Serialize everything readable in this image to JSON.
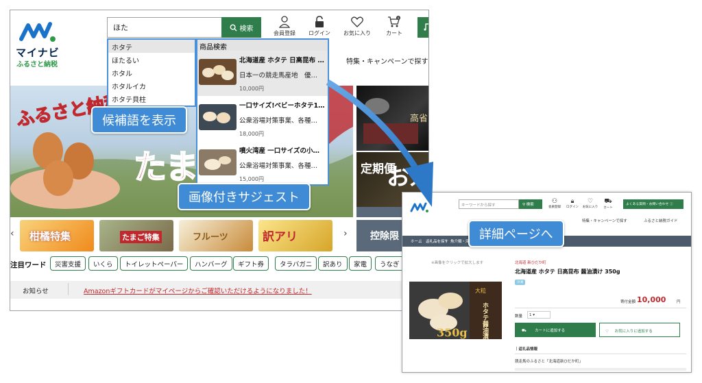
{
  "main": {
    "logo": {
      "line1": "マイナビ",
      "line2": "ふるさと納税"
    },
    "search": {
      "value": "ほた",
      "button_label": "検索"
    },
    "header_icons": [
      {
        "label": "会員登録",
        "icon": "person-icon"
      },
      {
        "label": "ログイン",
        "icon": "lock-icon"
      },
      {
        "label": "お気に入り",
        "icon": "heart-icon"
      },
      {
        "label": "カート",
        "icon": "cart-icon",
        "badge": "0"
      }
    ],
    "nav_text": "特集・キャンペーンで探す",
    "suggestions": [
      "ホタテ",
      "ほたるい",
      "ホタル",
      "ホタルイカ",
      "ホタテ貝柱"
    ],
    "product_suggest": {
      "header": "商品検索",
      "items": [
        {
          "name": "北海道産 ホタテ 日高昆布 …",
          "desc": "日本一の競走馬産地　優…",
          "price": "10,000円"
        },
        {
          "name": "一口サイズ!ベビーホタテ1…",
          "desc": "公衆浴場対策事業、各種…",
          "price": "18,000円"
        },
        {
          "name": "噴火湾産 一口サイズの小…",
          "desc": "公衆浴場対策事業、各種…",
          "price": "15,000円"
        }
      ]
    },
    "banner": {
      "text1": "ふるさと納税",
      "text2": "たま",
      "text3": "定期便",
      "text4": "お米",
      "text5": "控除限",
      "text6": "高省"
    },
    "thumbs": [
      {
        "label": "柑橘特集",
        "color": "#f5a623"
      },
      {
        "label": "たまご特集",
        "color": "#c9a66b"
      },
      {
        "label": "フルーツ",
        "color": "#e5c07b"
      },
      {
        "label": "訳アリ",
        "color": "#d6a52a"
      }
    ],
    "keywords_label": "注目ワード",
    "keywords": [
      "災害支援",
      "いくら",
      "トイレットペーパー",
      "ハンバーグ",
      "ギフト券",
      "タラバガニ",
      "訳あり",
      "家電",
      "うなぎ"
    ],
    "news": {
      "label": "お知らせ",
      "text": "Amazonギフトカードがマイページからご確認いただけるようになりました！"
    }
  },
  "callouts": {
    "suggest": "候補語を表示",
    "image_suggest": "画像付きサジェスト",
    "detail": "詳細ページへ"
  },
  "detail": {
    "search_placeholder": "キーワードから探す",
    "search_button": "検索",
    "header_icons": [
      "会員登録",
      "ログイン",
      "お気に入り",
      "カート"
    ],
    "faq_button": "よくある質問・お問い合わせ",
    "nav": [
      "特集・キャンペーンで探す",
      "ふるさと納税ガイド"
    ],
    "breadcrumb": [
      "ホーム",
      "返礼品を探す",
      "魚介類・海"
    ],
    "zoom_hint": "※画像をクリックで拡大します",
    "municipality": "北海道 新ひだか町",
    "title": "北海道産 ホタテ 日高昆布 醤油漬け 350g",
    "tag": "冷凍",
    "price_label": "寄付金額",
    "price": "10,000",
    "price_unit": "円",
    "qty_label": "数量",
    "qty_value": "1",
    "add_cart": "カートに追加する",
    "add_fav": "お気に入りに追加する",
    "section_title": "返礼品情報",
    "section_sub": "競走馬のふるさと「北海道新ひだか町」",
    "image_text": "ホタテ醤油漬",
    "image_weight": "350g",
    "image_badge": "大粒"
  },
  "colors": {
    "brand_green": "#2e7d4b",
    "callout_blue": "#3f8bd6",
    "price_red": "#c0282d"
  }
}
